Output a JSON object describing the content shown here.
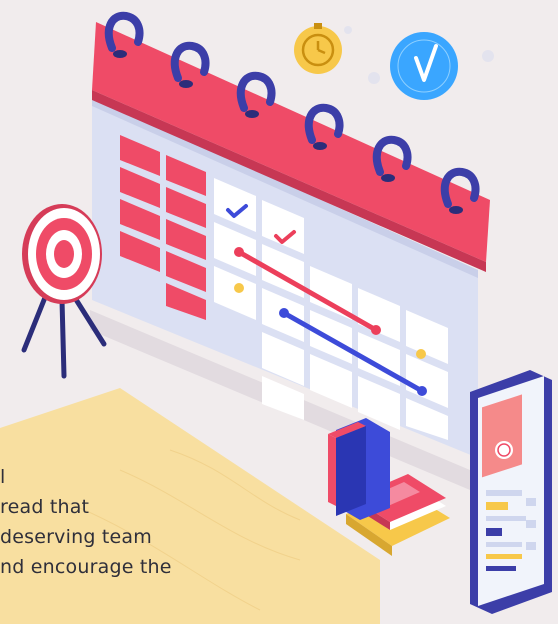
{
  "colors": {
    "background": "#f1eced",
    "calendar_red": "#ef4b67",
    "ring_blue": "#3c3ea8",
    "grid_blue": "#d9dff5",
    "paper_yellow": "#f8dfa0",
    "check_red": "#ec3f5b",
    "check_blue": "#3d4bd9",
    "clock_yellow": "#f7c84a",
    "clock_blue": "#3aa6ff"
  },
  "icons": [
    "target-icon",
    "stopwatch-icon",
    "clock-icon",
    "check-icon",
    "phone-icon",
    "books-icon",
    "calendar-icon"
  ],
  "text": {
    "line1": "l",
    "line2": "read that",
    "line3": "deserving team",
    "line4": "nd encourage the"
  }
}
